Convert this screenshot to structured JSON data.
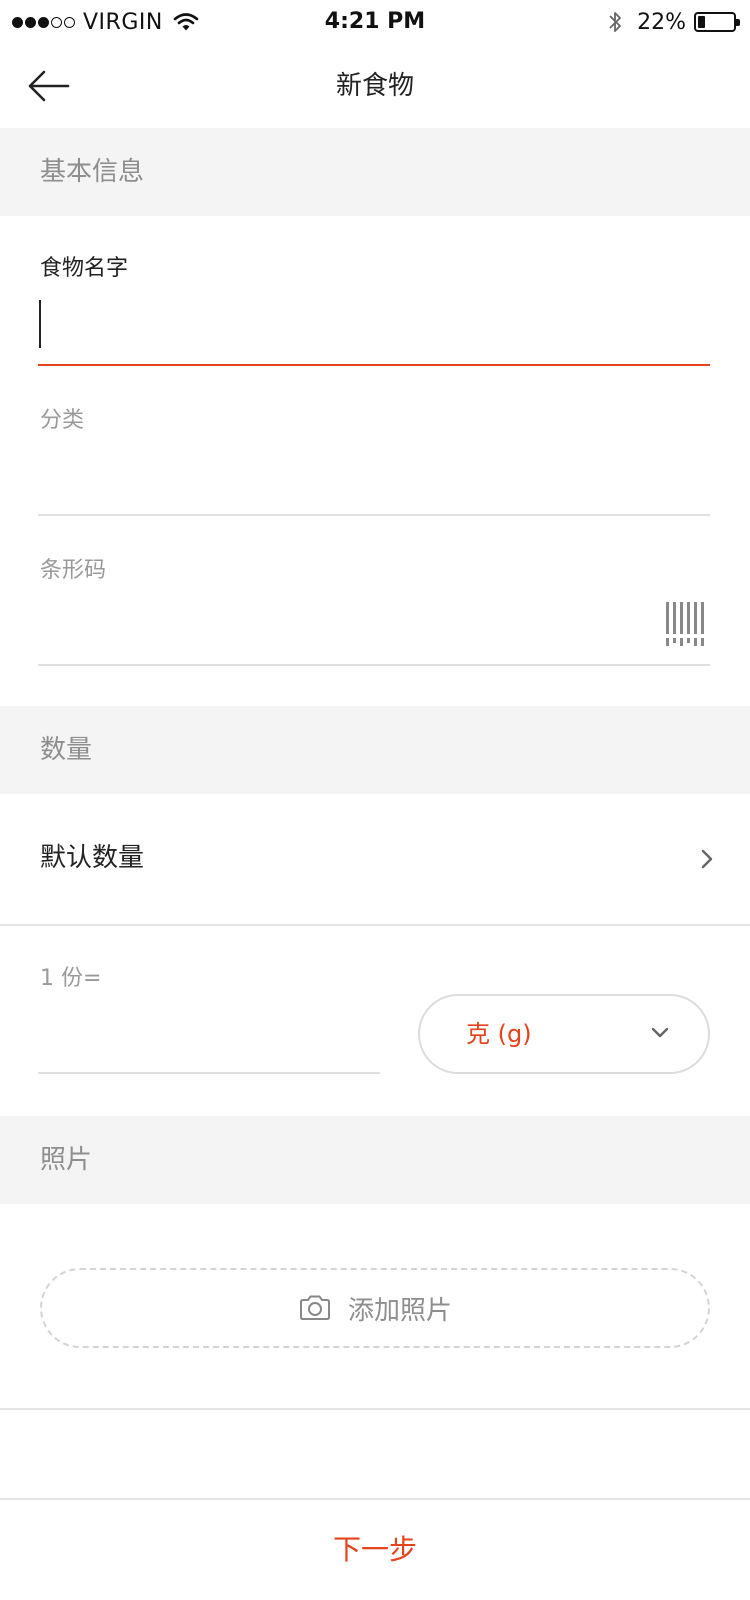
{
  "status_bar": {
    "carrier": "VIRGIN",
    "time": "4:21 PM",
    "battery_percent": "22%",
    "battery_level": 0.22,
    "signal_dots_filled": 3,
    "signal_dots_total": 5,
    "icons": [
      "wifi-icon",
      "bluetooth-icon",
      "battery-icon"
    ]
  },
  "nav": {
    "title": "新食物",
    "back_icon": "arrow-left-icon"
  },
  "sections": {
    "basic_info": "基本信息",
    "quantity": "数量",
    "photos": "照片"
  },
  "fields": {
    "food_name": {
      "label": "食物名字",
      "value": ""
    },
    "category": {
      "label": "分类",
      "value": ""
    },
    "barcode": {
      "label": "条形码",
      "value": "",
      "icon": "barcode-icon"
    }
  },
  "quantity": {
    "default_quantity_label": "默认数量",
    "serving_label": "1 份=",
    "serving_value": "",
    "unit_value": "克 (g)"
  },
  "photo": {
    "add_label": "添加照片",
    "icon": "camera-icon"
  },
  "footer": {
    "next_label": "下一步"
  },
  "colors": {
    "accent": "#e5431c",
    "section_bg": "#f4f4f4",
    "label_gray": "#999999",
    "divider": "#e0e0e0"
  }
}
